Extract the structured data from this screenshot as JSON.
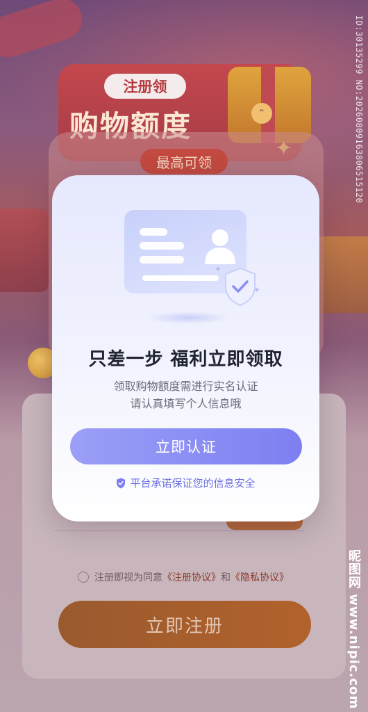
{
  "background": {
    "promo_pill": "注册领",
    "promo_title": "购物额度",
    "max_pill": "最高可领",
    "agreement": {
      "prefix": "注册即视为同意",
      "link1": "《注册协议》",
      "conj": "和",
      "link2": "《隐私协议》"
    },
    "register_button": "立即注册"
  },
  "watermark": {
    "id_text": "ID:30135299 NO:20260809163806515120",
    "site_text": "昵图网 www.nipic.com"
  },
  "modal": {
    "title": "只差一步 福利立即领取",
    "desc_line1": "领取购物额度需进行实名认证",
    "desc_line2": "请认真填写个人信息哦",
    "verify_button": "立即认证",
    "secure_note": "平台承诺保证您的信息安全",
    "icons": {
      "illustration": "id-card-icon",
      "badge": "shield-check-icon",
      "secure": "shield-icon"
    }
  },
  "colors": {
    "accent": "#7d7ff2",
    "accent_light": "#9b9ff6",
    "title_text": "#1f2330",
    "secure_text": "#6a6ee0"
  }
}
